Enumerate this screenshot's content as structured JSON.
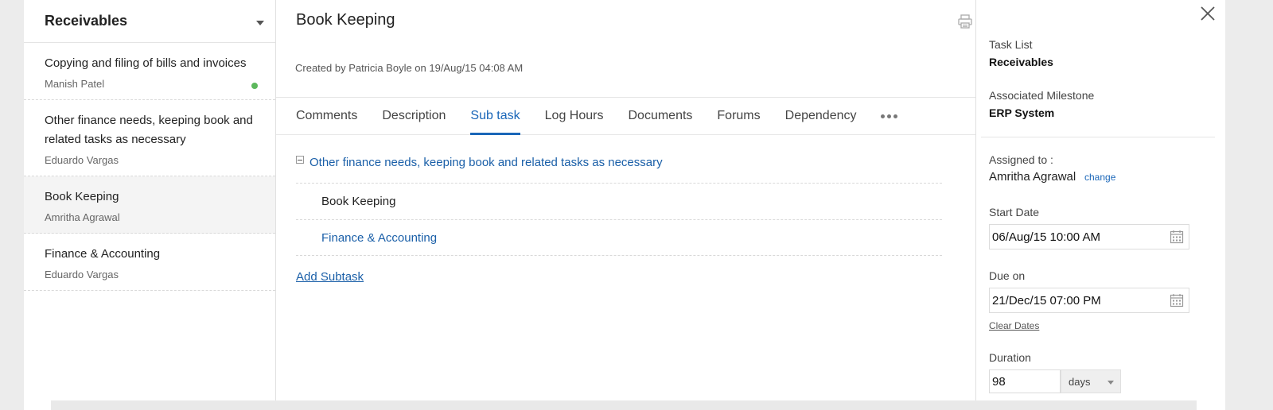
{
  "task_list": {
    "header": "Receivables",
    "items": [
      {
        "title": "Copying and filing of bills and invoices",
        "owner": "Manish Patel"
      },
      {
        "title": "Other finance needs, keeping book and related tasks as necessary",
        "owner": "Eduardo Vargas"
      },
      {
        "title": "Book Keeping",
        "owner": "Amritha Agrawal"
      },
      {
        "title": "Finance & Accounting",
        "owner": "Eduardo Vargas"
      }
    ]
  },
  "main": {
    "title": "Book Keeping",
    "created_by": "Created by Patricia Boyle on 19/Aug/15 04:08 AM",
    "tabs": [
      {
        "label": "Comments"
      },
      {
        "label": "Description"
      },
      {
        "label": "Sub task"
      },
      {
        "label": "Log Hours"
      },
      {
        "label": "Documents"
      },
      {
        "label": "Forums"
      },
      {
        "label": "Dependency"
      }
    ],
    "active_tab": "Sub task",
    "subtask_parent": "Other finance needs, keeping book and related tasks as necessary",
    "subtasks": [
      {
        "label": "Book Keeping"
      },
      {
        "label": "Finance & Accounting"
      }
    ],
    "add_subtask": "Add Subtask"
  },
  "details": {
    "task_list_label": "Task List",
    "task_list_value": "Receivables",
    "milestone_label": "Associated Milestone",
    "milestone_value": "ERP System",
    "assigned_label": "Assigned to :",
    "assigned_value": "Amritha Agrawal",
    "change_label": "change",
    "start_date_label": "Start Date",
    "start_date_value": "06/Aug/15 10:00 AM",
    "due_on_label": "Due on",
    "due_on_value": "21/Dec/15 07:00 PM",
    "clear_dates": "Clear Dates",
    "duration_label": "Duration",
    "duration_value": "98",
    "duration_unit": "days"
  },
  "colors": {
    "accent": "#1a66b8",
    "status_dot": "#5cb85c"
  }
}
